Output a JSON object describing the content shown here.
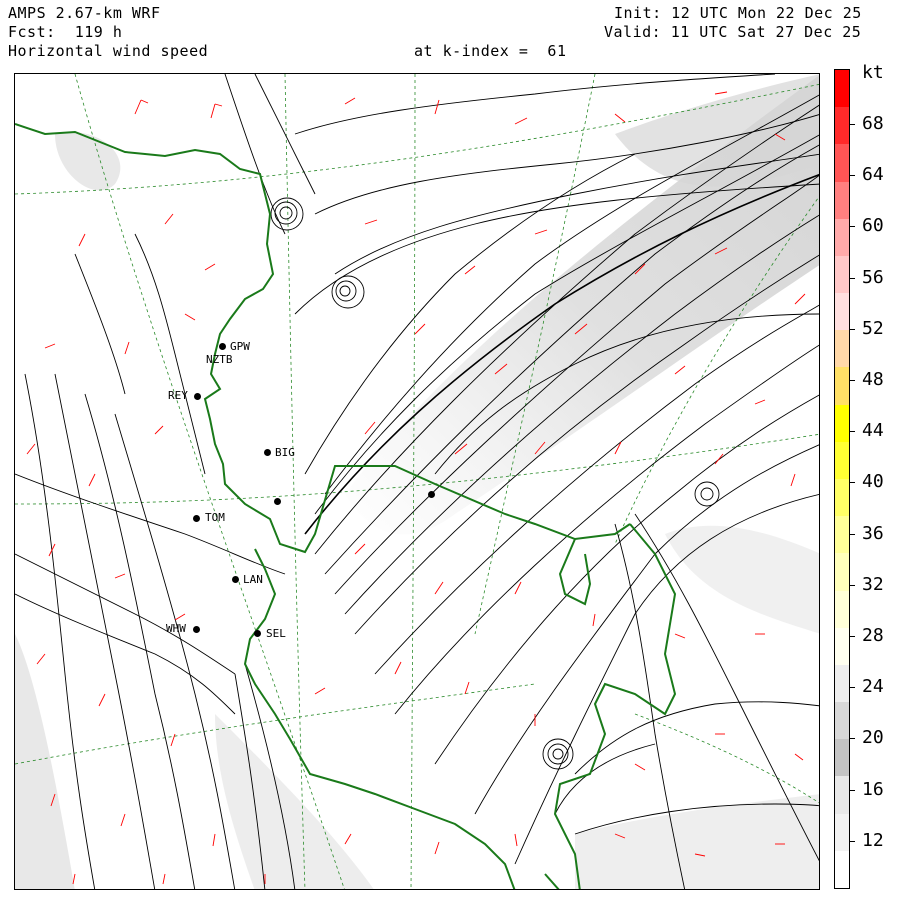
{
  "header": {
    "model": "AMPS 2.67-km WRF",
    "forecast": "Fcst:  119 h",
    "field": "Horizontal wind speed",
    "level": "at k-index =  61",
    "init": "Init: 12 UTC Mon 22 Dec 25",
    "valid": "Valid: 11 UTC Sat 27 Dec 25"
  },
  "colorbar": {
    "unit": "kt",
    "labels": [
      "68",
      "64",
      "60",
      "56",
      "52",
      "48",
      "44",
      "40",
      "36",
      "32",
      "28",
      "24",
      "20",
      "16",
      "12"
    ],
    "colors": [
      "#ff0000",
      "#ff2a2a",
      "#ff5555",
      "#ff8080",
      "#ffaaaa",
      "#ffc8c8",
      "#ffe0e0",
      "#ffd8a8",
      "#ffe066",
      "#ffff00",
      "#ffff33",
      "#ffff66",
      "#ffff99",
      "#ffffbb",
      "#ffffd8",
      "#fffff0",
      "#eeeeee",
      "#d8d8d8",
      "#c4c4c4",
      "#e8e8e8",
      "#f2f2f2",
      "#ffffff"
    ]
  },
  "stations": [
    {
      "id": "gpw",
      "label": "GPW"
    },
    {
      "id": "nztb",
      "label": "NZTB"
    },
    {
      "id": "rey",
      "label": "REY"
    },
    {
      "id": "big",
      "label": "BIG"
    },
    {
      "id": "tom",
      "label": "TOM"
    },
    {
      "id": "lan",
      "label": "LAN"
    },
    {
      "id": "whw",
      "label": "WHW"
    },
    {
      "id": "sel",
      "label": "SEL"
    }
  ],
  "map_features": {
    "streamline_color": "#000000",
    "barb_color": "#ff0000",
    "coast_color": "#1a7a1a",
    "grid_color": "#2a8a2a"
  }
}
